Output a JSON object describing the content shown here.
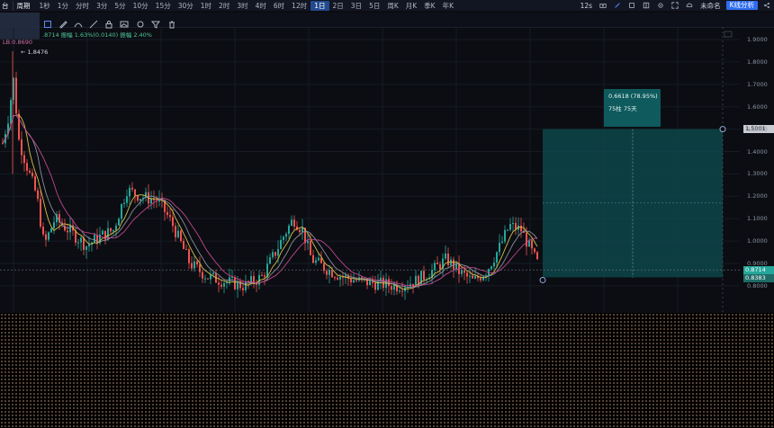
{
  "topbar": {
    "symbol_label": "台",
    "period_label": "周期",
    "intervals": [
      "1秒",
      "1分",
      "分时",
      "3分",
      "5分",
      "10分",
      "15分",
      "30分",
      "1时",
      "2时",
      "3时",
      "4时",
      "6时",
      "12时",
      "1日",
      "2日",
      "3日",
      "5日",
      "周K",
      "月K",
      "季K",
      "年K"
    ],
    "active_interval": "1日",
    "right_text": "12s",
    "account_label": "未命名",
    "analysis_button": "K线分析"
  },
  "info": {
    "line": ".8714  振幅 1.63%(0.0140)  振幅 2.40%",
    "lb_label": "LB:0.8690",
    "high_label": "1.8476"
  },
  "measure": {
    "line1": "0.6618 (78.95%)",
    "line2": "75柱 75天"
  },
  "yaxis": {
    "ticks": [
      "1.9000",
      "1.8000",
      "1.7000",
      "1.6000",
      "1.5000",
      "1.4000",
      "1.3000",
      "1.2000",
      "1.1000",
      "1.0000",
      "0.9000",
      "0.8000"
    ],
    "target_price": "1.5001",
    "current_price": "0.8714",
    "entry_price": "0.8383"
  },
  "colors": {
    "up": "#26a69a",
    "down": "#ef5350",
    "ma_yellow": "#d4c04a",
    "ma_pink": "#c2468f",
    "ma_grey": "#8a8f9c",
    "measure_fill": "#0e4d50",
    "accent": "#2f6df0"
  },
  "chart_data": {
    "type": "candlestick",
    "ylim": [
      0.75,
      1.95
    ],
    "last": 0.8714,
    "high": 1.8476,
    "target": 1.5001,
    "entry": 0.8383
  }
}
